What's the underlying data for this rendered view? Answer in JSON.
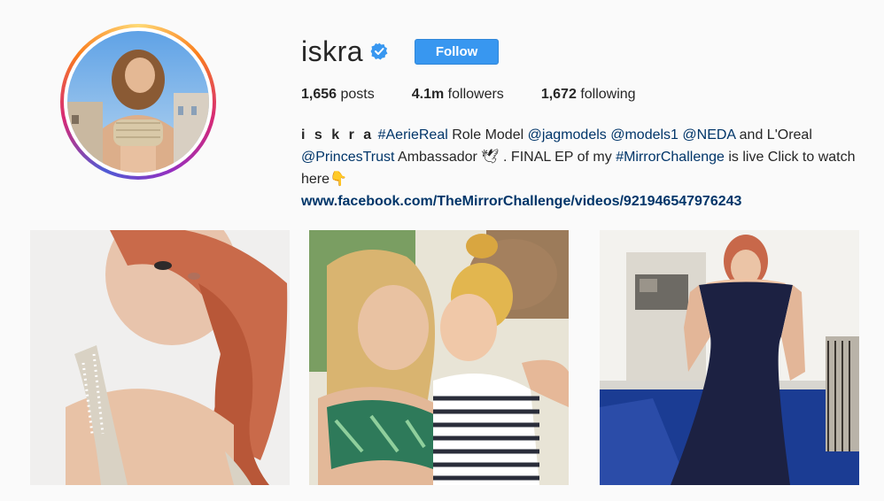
{
  "profile": {
    "username": "iskra",
    "follow_label": "Follow",
    "stats": {
      "posts_count": "1,656",
      "posts_label": "posts",
      "followers_count": "4.1m",
      "followers_label": "followers",
      "following_count": "1,672",
      "following_label": "following"
    },
    "bio": {
      "full_name": "iskra",
      "line1_tag1": "#AerieReal",
      "line1_text1": " Role Model ",
      "line1_tag2": "@jagmodels",
      "line1_space1": " ",
      "line1_tag3": "@models1",
      "line1_space2": " ",
      "line1_tag4": "@NEDA",
      "line1_text2": " and L'Oreal",
      "line2_tag1": "@PrincesTrust",
      "line2_text1": " Ambassador 🕊 . FINAL EP of my ",
      "line2_tag2": "#MirrorChallenge",
      "line2_text2": " is live Click to watch",
      "line3_text": "here👇",
      "website": "www.facebook.com/TheMirrorChallenge/videos/921946547976243"
    }
  },
  "colors": {
    "accent": "#3897f0",
    "link": "#003569",
    "background": "#fafafa"
  },
  "posts": [
    {
      "name": "post-1"
    },
    {
      "name": "post-2"
    },
    {
      "name": "post-3"
    }
  ]
}
